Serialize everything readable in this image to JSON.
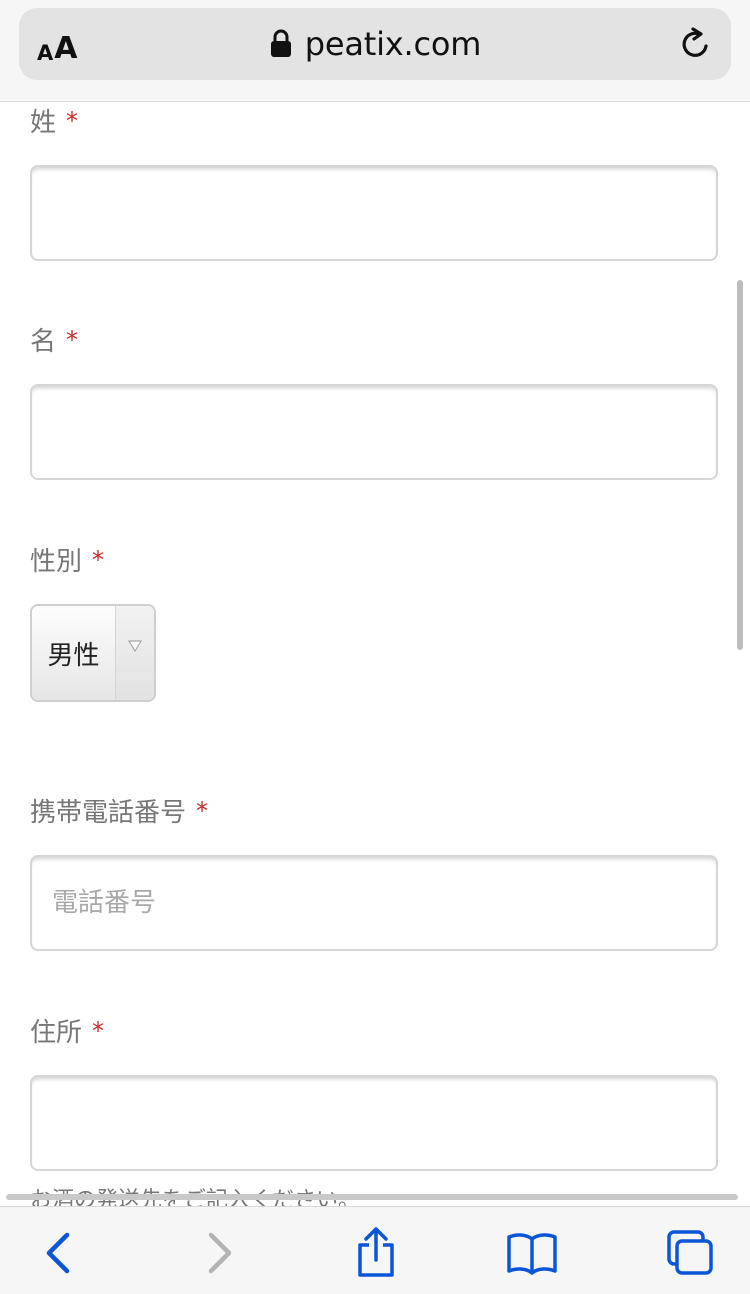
{
  "browser": {
    "aa_small": "A",
    "aa_large": "A",
    "url": "peatix.com",
    "icons": {
      "lock": "lock-icon",
      "reload": "reload-icon"
    }
  },
  "form": {
    "last_name": {
      "label": "姓",
      "required_mark": "*",
      "value": "",
      "placeholder": ""
    },
    "first_name": {
      "label": "名",
      "required_mark": "*",
      "value": "",
      "placeholder": ""
    },
    "gender": {
      "label": "性別",
      "required_mark": "*",
      "selected": "男性"
    },
    "phone": {
      "label": "携帯電話番号",
      "required_mark": "*",
      "value": "",
      "placeholder": "電話番号"
    },
    "address": {
      "label": "住所",
      "required_mark": "*",
      "value": "",
      "placeholder": "",
      "help": "お酒の発送先をご記入ください。"
    }
  },
  "toolbar": {
    "items": [
      "back-icon",
      "forward-icon",
      "share-icon",
      "bookmarks-icon",
      "tabs-icon"
    ]
  },
  "colors": {
    "accent": "#0a55d8",
    "required": "#cc2a2a",
    "label": "#777777",
    "disabled": "#b3b3b3"
  }
}
